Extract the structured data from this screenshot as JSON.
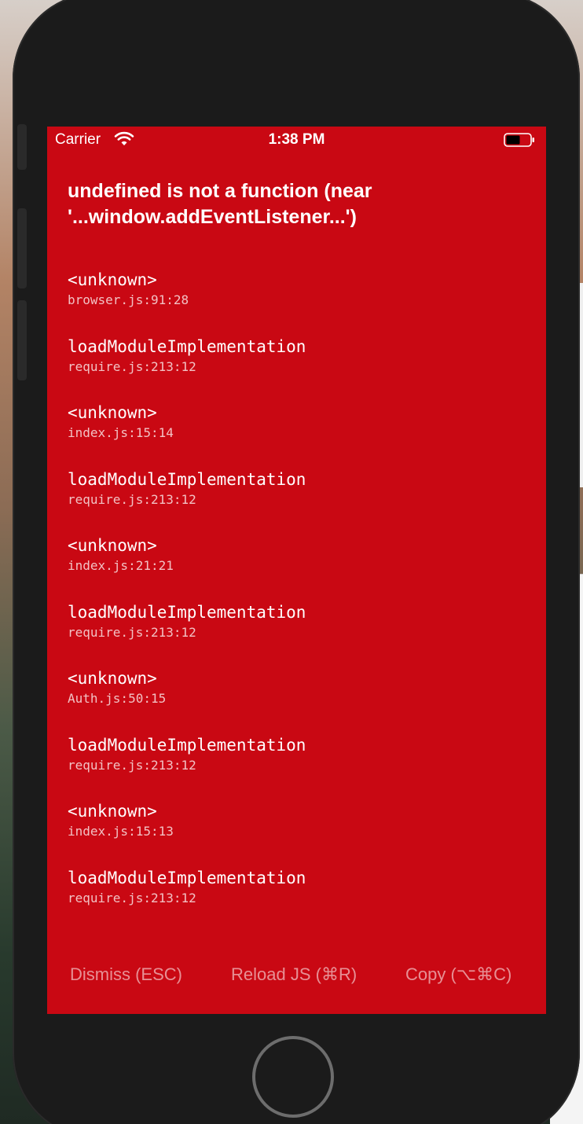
{
  "status_bar": {
    "carrier": "Carrier",
    "time": "1:38 PM",
    "wifi_icon": "wifi-icon",
    "battery_icon": "battery-icon"
  },
  "error": {
    "title_line1": "undefined is not a function (near",
    "title_line2": "'...window.addEventListener...')"
  },
  "stack": [
    {
      "method": "<unknown>",
      "location": "browser.js:91:28"
    },
    {
      "method": "loadModuleImplementation",
      "location": "require.js:213:12"
    },
    {
      "method": "<unknown>",
      "location": "index.js:15:14"
    },
    {
      "method": "loadModuleImplementation",
      "location": "require.js:213:12"
    },
    {
      "method": "<unknown>",
      "location": "index.js:21:21"
    },
    {
      "method": "loadModuleImplementation",
      "location": "require.js:213:12"
    },
    {
      "method": "<unknown>",
      "location": "Auth.js:50:15"
    },
    {
      "method": "loadModuleImplementation",
      "location": "require.js:213:12"
    },
    {
      "method": "<unknown>",
      "location": "index.js:15:13"
    },
    {
      "method": "loadModuleImplementation",
      "location": "require.js:213:12"
    }
  ],
  "toolbar": {
    "dismiss_label": "Dismiss (ESC)",
    "reload_label": "Reload JS (⌘R)",
    "copy_label": "Copy (⌥⌘C)"
  },
  "colors": {
    "error_background": "#c90813",
    "bezel": "#1b1b1b"
  }
}
